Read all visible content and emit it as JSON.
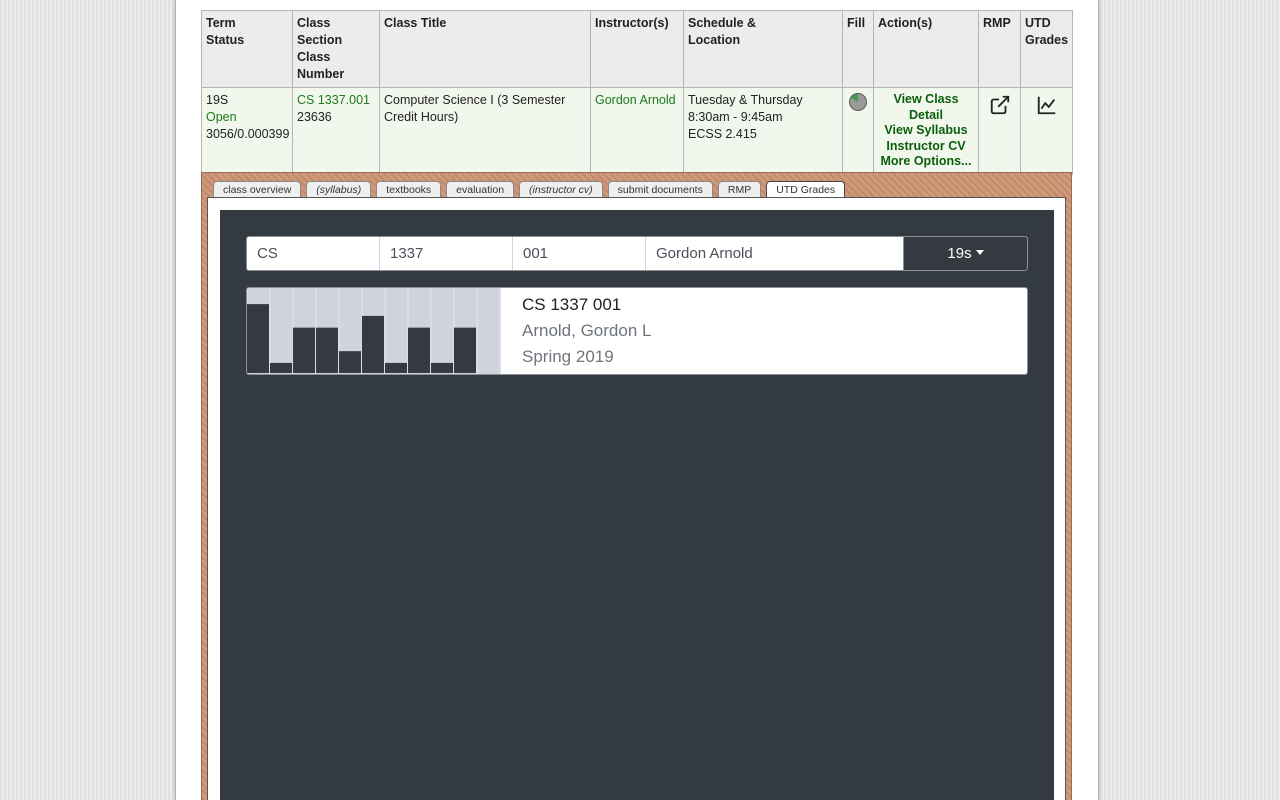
{
  "table": {
    "headers": {
      "term_status": [
        "Term",
        "Status"
      ],
      "class_section": [
        "Class",
        "Section",
        "Class",
        "Number"
      ],
      "class_title": "Class Title",
      "instructors": "Instructor(s)",
      "schedule": [
        "Schedule &",
        "Location"
      ],
      "fill": "Fill",
      "actions": "Action(s)",
      "rmp": "RMP",
      "utd_grades": [
        "UTD",
        "Grades"
      ]
    },
    "row": {
      "term": "19S",
      "status": "Open",
      "ratio": "3056/0.000399",
      "section": "CS 1337.001",
      "class_number": "23636",
      "title": "Computer Science I (3 Semester Credit Hours)",
      "instructor": "Gordon Arnold",
      "days": "Tuesday & Thursday",
      "time": "8:30am - 9:45am",
      "location": "ECSS 2.415",
      "actions": [
        "View Class Detail",
        "View Syllabus",
        "Instructor CV",
        "More Options..."
      ]
    }
  },
  "tabs": [
    {
      "label": "class overview",
      "italic": false,
      "active": false
    },
    {
      "label": "(syllabus)",
      "italic": true,
      "active": false
    },
    {
      "label": "textbooks",
      "italic": false,
      "active": false
    },
    {
      "label": "evaluation",
      "italic": false,
      "active": false
    },
    {
      "label": "(instructor cv)",
      "italic": true,
      "active": false
    },
    {
      "label": "submit documents",
      "italic": false,
      "active": false
    },
    {
      "label": "RMP",
      "italic": false,
      "active": false
    },
    {
      "label": "UTD Grades",
      "italic": false,
      "active": true
    }
  ],
  "search": {
    "subject": "CS",
    "number": "1337",
    "section": "001",
    "professor": "Gordon Arnold",
    "term": "19s"
  },
  "card": {
    "title": "CS 1337 001",
    "professor": "Arnold, Gordon L",
    "semester": "Spring 2019"
  },
  "chart_data": {
    "type": "bar",
    "values": [
      0.82,
      0.12,
      0.54,
      0.54,
      0.26,
      0.68,
      0.12,
      0.54,
      0.12,
      0.54,
      0
    ],
    "ylim": [
      0,
      1
    ],
    "bar_color": "#343a40",
    "background_color": "#cfd4dc"
  },
  "colors": {
    "accent_green": "#1c7a1c",
    "action_green": "#0b5f0b",
    "dark_panel": "#343a41",
    "tab_frame": "#c89270"
  },
  "icons": {
    "rmp": "external-link-icon",
    "grades": "line-chart-icon",
    "fill": "pie-fill-icon",
    "term_dropdown": "caret-down-icon"
  }
}
